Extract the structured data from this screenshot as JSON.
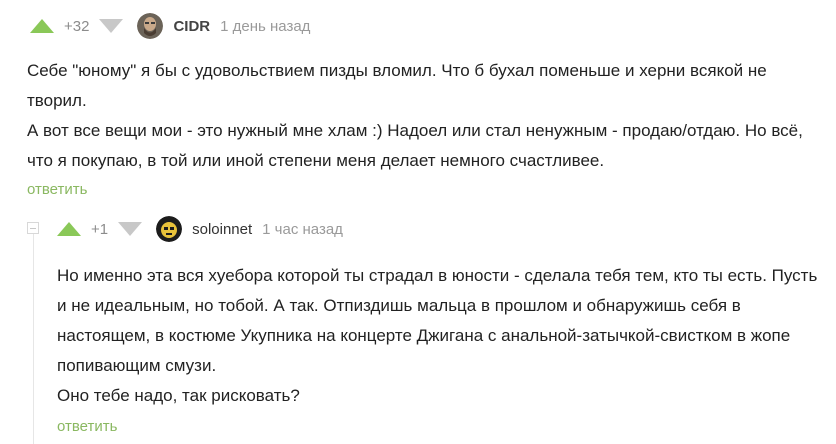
{
  "comments": [
    {
      "rating": "+32",
      "author": "CIDR",
      "time": "1 день назад",
      "paragraphs": [
        "Себе \"юному\" я бы с удовольствием пизды вломил. Что б бухал поменьше и херни всякой не творил.",
        "А вот все вещи мои - это нужный мне хлам :) Надоел или стал ненужным - продаю/отдаю. Но всё, что я покупаю, в той или иной степени меня делает немного счастливее."
      ],
      "reply_label": "ответить"
    },
    {
      "rating": "+1",
      "author": "soloinnet",
      "time": "1 час назад",
      "paragraphs": [
        "Но именно эта вся хуебора которой ты страдал в юности - сделала тебя тем, кто ты есть. Пусть и не идеальным, но тобой. А так. Отпиздишь мальца в прошлом и обнаружишь себя в настоящем, в костюме Укупника на концерте Джигана с анальной-затычкой-свистком в жопе попивающим смузи.",
        "Оно тебе надо, так рисковать?"
      ],
      "reply_label": "ответить"
    }
  ],
  "colors": {
    "upvote": "#8ac858",
    "downvote": "#c8c8c8",
    "reply_link": "#8ab861"
  }
}
